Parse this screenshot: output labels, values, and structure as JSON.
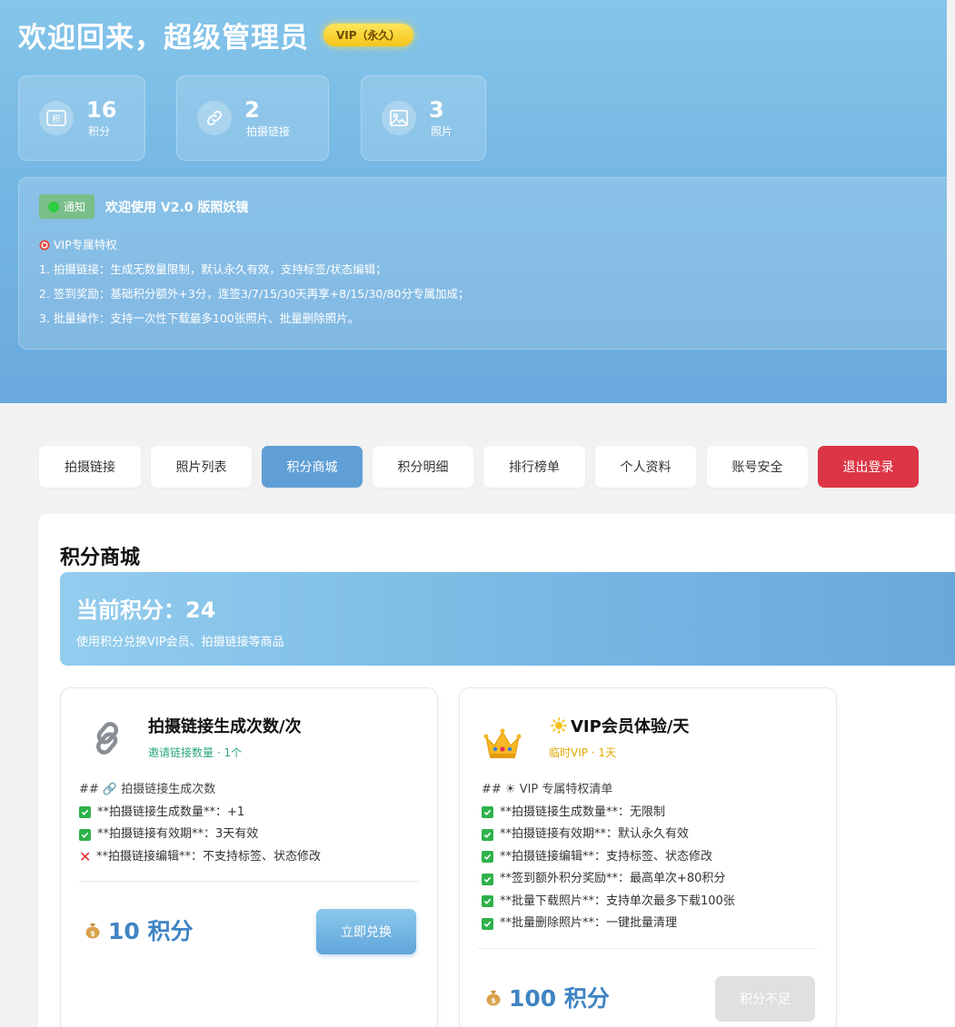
{
  "header": {
    "title": "欢迎回来，超级管理员",
    "vip_badge": "VIP（永久）"
  },
  "stats": [
    {
      "icon": "points-ticket-icon",
      "value": "16",
      "label": "积分"
    },
    {
      "icon": "link-icon",
      "value": "2",
      "label": "拍摄链接"
    },
    {
      "icon": "image-icon",
      "value": "3",
      "label": "照片"
    }
  ],
  "notice": {
    "tag": "通知",
    "title": "欢迎使用 V2.0 版照妖镜",
    "lines": [
      "VIP专属特权",
      "1. 拍摄链接：生成无数量限制，默认永久有效，支持标签/状态编辑；",
      "2. 签到奖励：基础积分额外+3分，连签3/7/15/30天再享+8/15/30/80分专属加成；",
      "3. 批量操作：支持一次性下载最多100张照片、批量删除照片。"
    ]
  },
  "tabs": [
    {
      "label": "拍摄链接",
      "state": "normal"
    },
    {
      "label": "照片列表",
      "state": "normal"
    },
    {
      "label": "积分商城",
      "state": "active"
    },
    {
      "label": "积分明细",
      "state": "normal"
    },
    {
      "label": "排行榜单",
      "state": "normal"
    },
    {
      "label": "个人资料",
      "state": "normal"
    },
    {
      "label": "账号安全",
      "state": "normal"
    },
    {
      "label": "退出登录",
      "state": "danger"
    }
  ],
  "shop": {
    "title": "积分商城",
    "current_points": "当前积分：24",
    "subtitle": "使用积分兑换VIP会员、拍摄链接等商品",
    "products": [
      {
        "icon": "chain-link-icon",
        "name": "拍摄链接生成次数/次",
        "sub": "邀请链接数量 · 1个",
        "desc_header": "## 🔗 拍摄链接生成次数",
        "features": [
          {
            "ok": true,
            "text": "**拍摄链接生成数量**：+1"
          },
          {
            "ok": true,
            "text": "**拍摄链接有效期**：3天有效"
          },
          {
            "ok": false,
            "text": "**拍摄链接编辑**：不支持标签、状态修改"
          }
        ],
        "price": "10 积分",
        "button": "立即兑换"
      },
      {
        "icon": "crown-icon",
        "name": "VIP会员体验/天",
        "sub": "临时VIP · 1天",
        "desc_header": "## ☀ VIP 专属特权清单",
        "features": [
          {
            "ok": true,
            "text": "**拍摄链接生成数量**：无限制"
          },
          {
            "ok": true,
            "text": "**拍摄链接有效期**：默认永久有效"
          },
          {
            "ok": true,
            "text": "**拍摄链接编辑**：支持标签、状态修改"
          },
          {
            "ok": true,
            "text": "**签到额外积分奖励**：最高单次+80积分"
          },
          {
            "ok": true,
            "text": "**批量下载照片**：支持单次最多下载100张"
          },
          {
            "ok": true,
            "text": "**批量删除照片**：一键批量清理"
          }
        ],
        "price": "100 积分",
        "button": "积分不足"
      }
    ]
  },
  "colors": {
    "accent": "#5f9fd6",
    "danger": "#dc3545",
    "price": "#3f84c4",
    "check": "#2db24a"
  }
}
